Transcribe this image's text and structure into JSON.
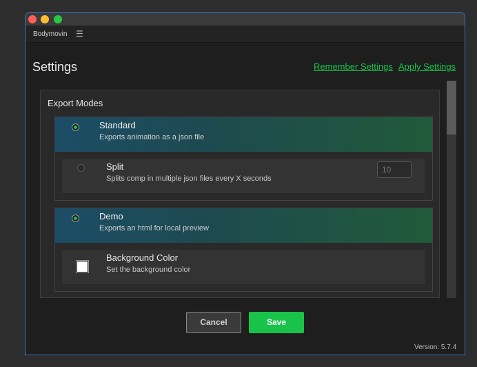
{
  "panel": {
    "name": "Bodymovin",
    "menu_icon": "hamburger-menu-icon"
  },
  "header": {
    "title": "Settings",
    "remember_label": "Remember Settings",
    "apply_label": "Apply Settings"
  },
  "export_modes": {
    "title": "Export Modes",
    "standard": {
      "name": "Standard",
      "description": "Exports animation as a json file",
      "selected": true,
      "split": {
        "name": "Split",
        "description": "Splits comp in multiple json files every X seconds",
        "seconds_placeholder": "10"
      }
    },
    "demo": {
      "name": "Demo",
      "description": "Exports an html for local preview",
      "selected": true,
      "background_color": {
        "name": "Background Color",
        "description": "Set the background color",
        "value": "#ffffff"
      }
    }
  },
  "footer": {
    "cancel_label": "Cancel",
    "save_label": "Save",
    "version": "Version: 5.7.4"
  },
  "colors": {
    "accent": "#19c34a",
    "window_border": "#3a72c4"
  }
}
